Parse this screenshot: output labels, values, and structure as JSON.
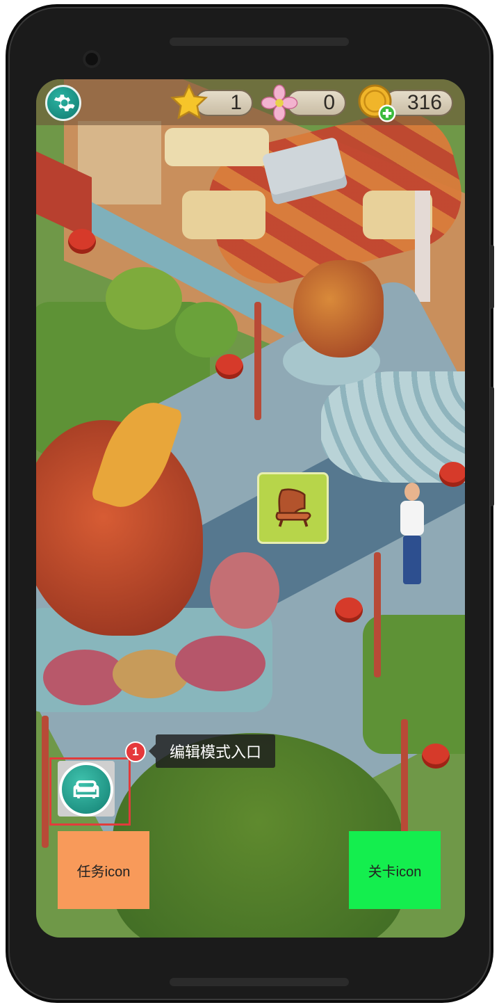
{
  "hud": {
    "stars": "1",
    "flowers": "0",
    "coins": "316"
  },
  "colors": {
    "teal_button": "#1a9a8a",
    "badge_red": "#e5393b",
    "highlight_red": "#e23b3b",
    "task_button": "#f89a5a",
    "level_button": "#14ee4e"
  },
  "icons": {
    "settings": "gear-icon",
    "stars": "star-icon",
    "flowers": "flower-icon",
    "coins": "coin-plus-icon",
    "furniture": "chair-icon",
    "edit_mode": "sofa-icon"
  },
  "edit_mode": {
    "badge_number": "1",
    "tooltip": "编辑模式入口"
  },
  "buttons": {
    "task": "任务icon",
    "level": "关卡icon"
  }
}
